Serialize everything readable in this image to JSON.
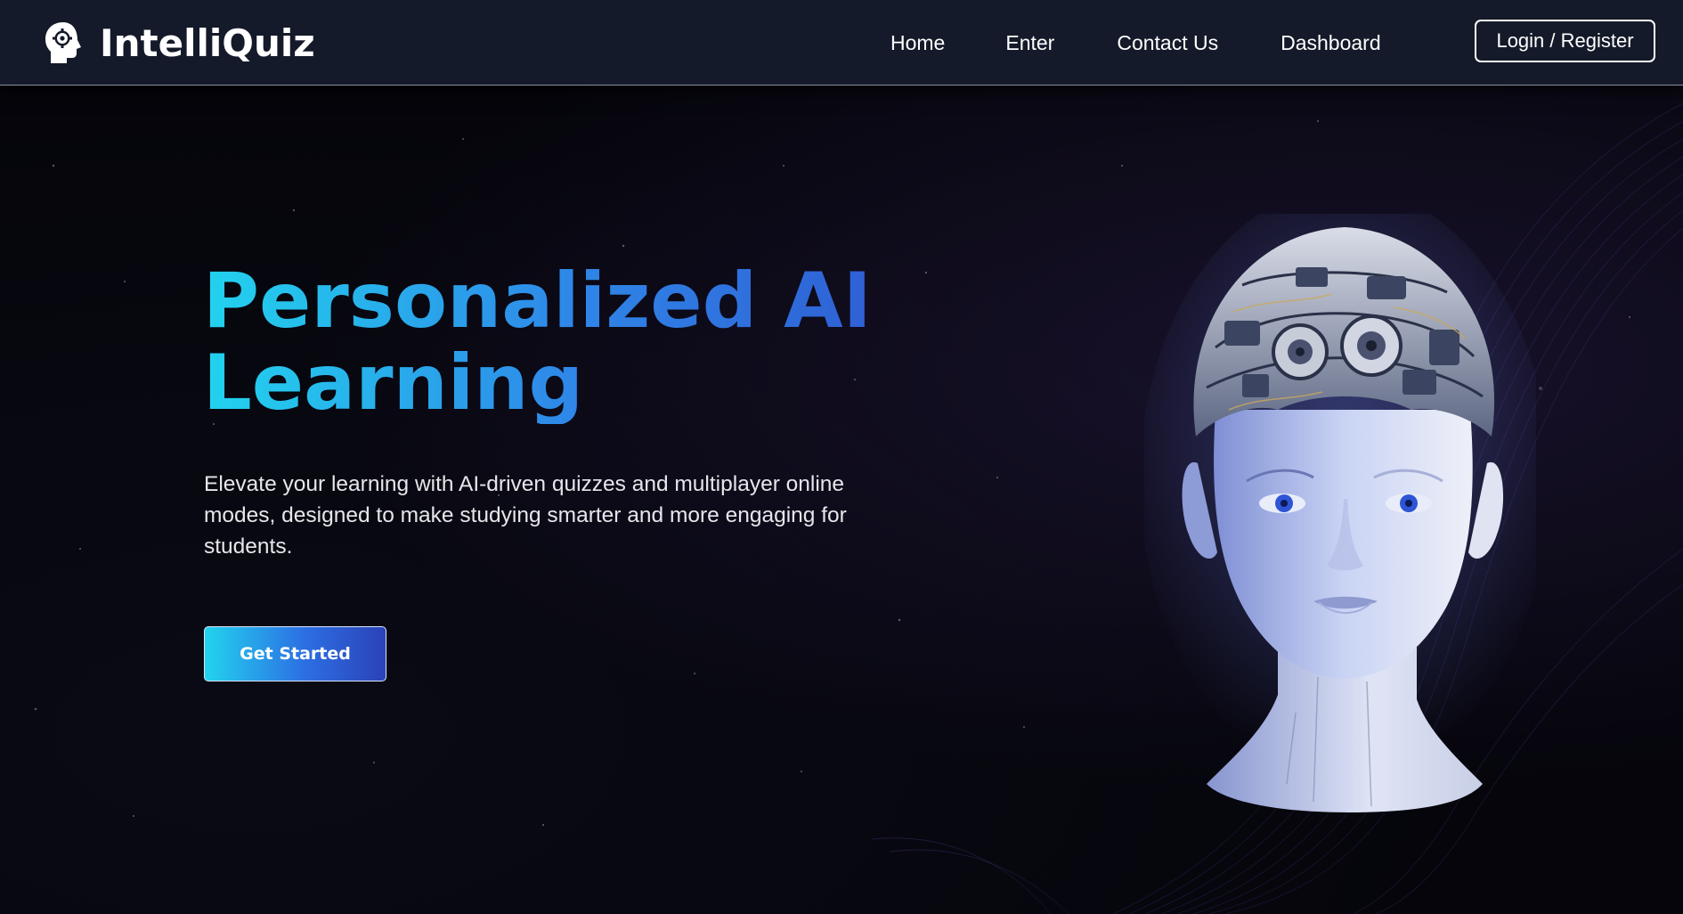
{
  "brand": {
    "name": "IntelliQuiz",
    "icon": "head-gear-icon"
  },
  "nav": {
    "items": [
      {
        "label": "Home"
      },
      {
        "label": "Enter"
      },
      {
        "label": "Contact Us"
      },
      {
        "label": "Dashboard"
      }
    ],
    "login_label": "Login / Register"
  },
  "hero": {
    "title_line1": "Personalized AI",
    "title_line2": "Learning",
    "description": "Elevate your learning with AI-driven quizzes and multiplayer online modes, designed to make studying smarter and more engaging for students.",
    "cta_label": "Get Started",
    "illustration": "ai-robot-head-illustration"
  },
  "colors": {
    "nav_bg": "#141a29",
    "page_bg": "#05050b",
    "accent_start": "#22d3ee",
    "accent_end": "#2b42b8"
  }
}
